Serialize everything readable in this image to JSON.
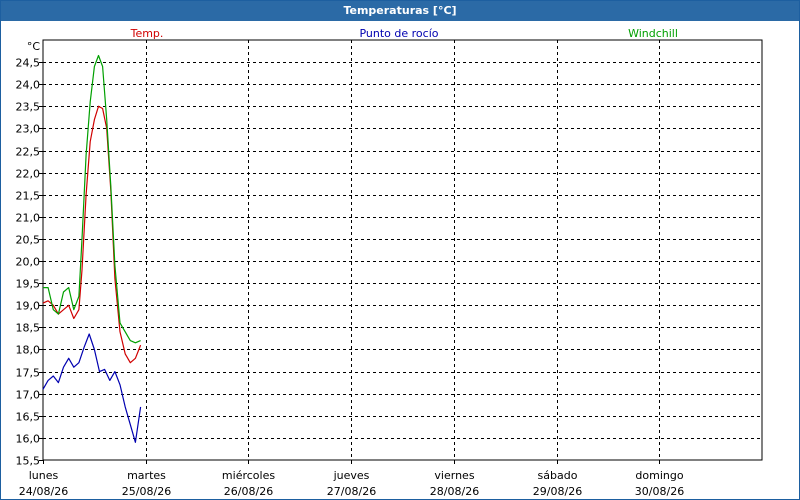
{
  "window": {
    "title": "Temperaturas [°C]"
  },
  "chart_data": {
    "type": "line",
    "title": "Temperaturas [°C]",
    "ylabel": "°C",
    "ylim": [
      15.5,
      25.0
    ],
    "yticks": [
      "15,5",
      "16,0",
      "16,5",
      "17,0",
      "17,5",
      "18,0",
      "18,5",
      "19,0",
      "19,5",
      "20,0",
      "20,5",
      "21,0",
      "21,5",
      "22,0",
      "22,5",
      "23,0",
      "23,5",
      "24,0",
      "24,5"
    ],
    "ytick_values": [
      15.5,
      16.0,
      16.5,
      17.0,
      17.5,
      18.0,
      18.5,
      19.0,
      19.5,
      20.0,
      20.5,
      21.0,
      21.5,
      22.0,
      22.5,
      23.0,
      23.5,
      24.0,
      24.5
    ],
    "xlim": [
      0,
      7
    ],
    "xticks": [
      {
        "day": "lunes",
        "date": "24/08/26"
      },
      {
        "day": "martes",
        "date": "25/08/26"
      },
      {
        "day": "miércoles",
        "date": "26/08/26"
      },
      {
        "day": "jueves",
        "date": "27/08/26"
      },
      {
        "day": "viernes",
        "date": "28/08/26"
      },
      {
        "day": "sábado",
        "date": "29/08/26"
      },
      {
        "day": "domingo",
        "date": "30/08/26"
      }
    ],
    "grid": true,
    "legend_position": "top",
    "series": [
      {
        "name": "Temp.",
        "color": "#d00000",
        "points": [
          [
            0.0,
            19.05
          ],
          [
            0.05,
            19.1
          ],
          [
            0.1,
            19.0
          ],
          [
            0.15,
            18.8
          ],
          [
            0.2,
            18.9
          ],
          [
            0.25,
            19.0
          ],
          [
            0.3,
            18.7
          ],
          [
            0.35,
            18.9
          ],
          [
            0.38,
            19.8
          ],
          [
            0.42,
            21.5
          ],
          [
            0.46,
            22.7
          ],
          [
            0.5,
            23.2
          ],
          [
            0.54,
            23.5
          ],
          [
            0.58,
            23.45
          ],
          [
            0.62,
            23.0
          ],
          [
            0.66,
            21.6
          ],
          [
            0.7,
            19.6
          ],
          [
            0.75,
            18.4
          ],
          [
            0.8,
            17.9
          ],
          [
            0.85,
            17.7
          ],
          [
            0.9,
            17.8
          ],
          [
            0.95,
            18.1
          ]
        ]
      },
      {
        "name": "Punto de rocío",
        "color": "#0000b0",
        "points": [
          [
            0.0,
            17.1
          ],
          [
            0.05,
            17.3
          ],
          [
            0.1,
            17.4
          ],
          [
            0.15,
            17.25
          ],
          [
            0.2,
            17.6
          ],
          [
            0.25,
            17.8
          ],
          [
            0.3,
            17.6
          ],
          [
            0.35,
            17.7
          ],
          [
            0.4,
            18.05
          ],
          [
            0.45,
            18.35
          ],
          [
            0.5,
            18.0
          ],
          [
            0.55,
            17.5
          ],
          [
            0.6,
            17.55
          ],
          [
            0.65,
            17.3
          ],
          [
            0.7,
            17.5
          ],
          [
            0.75,
            17.2
          ],
          [
            0.8,
            16.7
          ],
          [
            0.85,
            16.3
          ],
          [
            0.9,
            15.9
          ],
          [
            0.95,
            16.7
          ]
        ]
      },
      {
        "name": "Windchill",
        "color": "#00a000",
        "points": [
          [
            0.0,
            19.4
          ],
          [
            0.05,
            19.4
          ],
          [
            0.1,
            18.9
          ],
          [
            0.15,
            18.8
          ],
          [
            0.2,
            19.3
          ],
          [
            0.25,
            19.4
          ],
          [
            0.3,
            18.9
          ],
          [
            0.35,
            19.2
          ],
          [
            0.38,
            20.5
          ],
          [
            0.42,
            22.4
          ],
          [
            0.46,
            23.6
          ],
          [
            0.5,
            24.4
          ],
          [
            0.54,
            24.65
          ],
          [
            0.58,
            24.4
          ],
          [
            0.62,
            23.2
          ],
          [
            0.66,
            21.7
          ],
          [
            0.7,
            19.9
          ],
          [
            0.75,
            18.6
          ],
          [
            0.8,
            18.4
          ],
          [
            0.85,
            18.2
          ],
          [
            0.9,
            18.15
          ],
          [
            0.95,
            18.2
          ]
        ]
      }
    ]
  }
}
